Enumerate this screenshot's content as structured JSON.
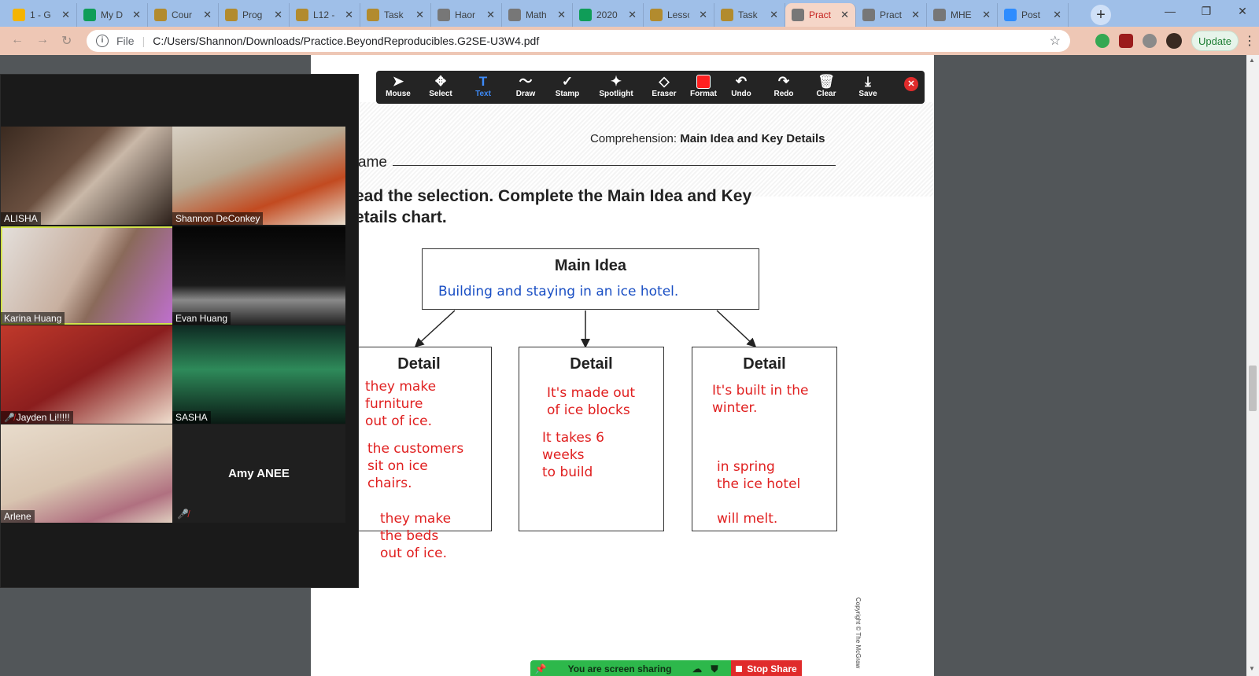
{
  "browser": {
    "tabs": [
      {
        "label": "1 - G",
        "color": "#f4b400"
      },
      {
        "label": "My D",
        "color": "#0f9d58"
      },
      {
        "label": "Cour",
        "color": "#b28b2e"
      },
      {
        "label": "Prog",
        "color": "#b28b2e"
      },
      {
        "label": "L12 -",
        "color": "#b28b2e"
      },
      {
        "label": "Task",
        "color": "#b28b2e"
      },
      {
        "label": "Haor",
        "color": "#777777"
      },
      {
        "label": "Math",
        "color": "#777777"
      },
      {
        "label": "2020",
        "color": "#0f9d58"
      },
      {
        "label": "Lesso",
        "color": "#b28b2e"
      },
      {
        "label": "Task",
        "color": "#b28b2e"
      },
      {
        "label": "Pract",
        "color": "#777777"
      },
      {
        "label": "Pract",
        "color": "#777777"
      },
      {
        "label": "MHE",
        "color": "#777777"
      },
      {
        "label": "Post",
        "color": "#2d8cff"
      }
    ],
    "close_glyph": "✕",
    "new_tab": "+",
    "window_controls": {
      "minimize": "—",
      "restore": "❐",
      "close": "✕"
    },
    "url_scheme": "File",
    "url": "C:/Users/Shannon/Downloads/Practice.BeyondReproducibles.G2SE-U3W4.pdf",
    "update_label": "Update"
  },
  "annotation_toolbar": {
    "tools": [
      {
        "label": "Mouse",
        "icon": "cursor-icon",
        "glyph": "➤"
      },
      {
        "label": "Select",
        "icon": "move-icon",
        "glyph": "✥"
      },
      {
        "label": "Text",
        "icon": "text-icon",
        "glyph": "T"
      },
      {
        "label": "Draw",
        "icon": "draw-icon",
        "glyph": "〜"
      },
      {
        "label": "Stamp",
        "icon": "stamp-icon",
        "glyph": "✓"
      },
      {
        "label": "Spotlight",
        "icon": "spotlight-icon",
        "glyph": "✦"
      },
      {
        "label": "Eraser",
        "icon": "eraser-icon",
        "glyph": "◇"
      },
      {
        "label": "Format",
        "icon": "format-icon",
        "glyph": ""
      },
      {
        "label": "Undo",
        "icon": "undo-icon",
        "glyph": "↶"
      },
      {
        "label": "Redo",
        "icon": "redo-icon",
        "glyph": "↷"
      },
      {
        "label": "Clear",
        "icon": "trash-icon",
        "glyph": "🗑"
      },
      {
        "label": "Save",
        "icon": "save-icon",
        "glyph": "⤓"
      }
    ],
    "active_tool": "Text",
    "format_color": "#ff2020"
  },
  "gallery": {
    "participants": [
      {
        "name": "ALISHA",
        "muted": false,
        "speaking": false
      },
      {
        "name": "Shannon DeConkey",
        "muted": false,
        "speaking": false
      },
      {
        "name": "Karina Huang",
        "muted": false,
        "speaking": true
      },
      {
        "name": "Evan Huang",
        "muted": false,
        "speaking": false
      },
      {
        "name": "Jayden Li!!!!!",
        "muted": true,
        "speaking": false
      },
      {
        "name": "SASHA",
        "muted": false,
        "speaking": false
      },
      {
        "name": "Arlene",
        "muted": false,
        "speaking": false
      }
    ],
    "no_video_participant": {
      "name": "Amy ANEE",
      "muted": true
    }
  },
  "document": {
    "header_prefix": "Comprehension: ",
    "header_bold": "Main Idea and Key Details",
    "name_label": "ame",
    "instructions": "ead the selection. Complete the Main Idea and Key etails chart.",
    "main_box_title": "Main Idea",
    "main_idea_answer": "Building and staying in an ice hotel.",
    "detail_title": "Detail",
    "detail1_notes": [
      "they make\nfurniture\nout of ice.",
      "the customers\nsit on ice\nchairs.",
      "they make\nthe beds\nout of ice."
    ],
    "detail2_notes": [
      "It's made out\nof ice blocks",
      "It takes 6\nweeks\nto build"
    ],
    "detail3_notes": [
      "It's built in the\nwinter.",
      "in spring\nthe ice hotel\n\nwill melt."
    ],
    "copyright": "Copyright © The McGraw"
  },
  "screen_share": {
    "status": "You are screen sharing",
    "stop_label": "Stop Share"
  }
}
